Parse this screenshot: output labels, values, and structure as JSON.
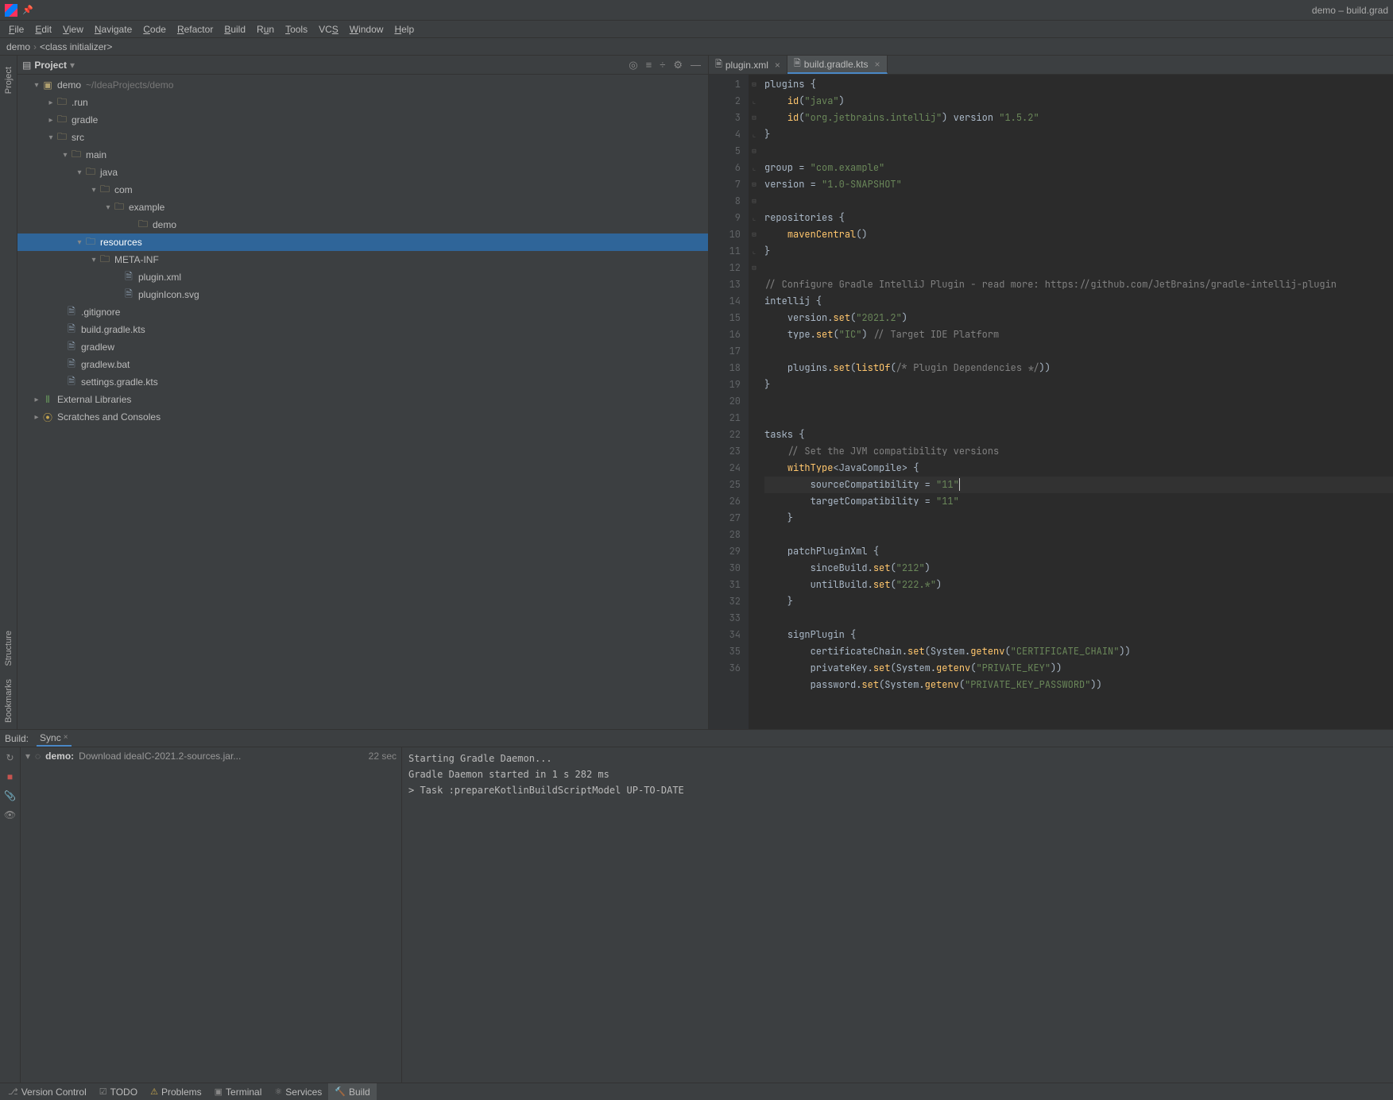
{
  "window_title": "demo – build.grad",
  "menu": [
    "File",
    "Edit",
    "View",
    "Navigate",
    "Code",
    "Refactor",
    "Build",
    "Run",
    "Tools",
    "VCS",
    "Window",
    "Help"
  ],
  "breadcrumbs": [
    "demo",
    "<class initializer>"
  ],
  "project_panel": {
    "title": "Project",
    "tree": {
      "root": {
        "label": "demo",
        "hint": "~/IdeaProjects/demo"
      },
      "run": ".run",
      "gradle": "gradle",
      "src": "src",
      "main": "main",
      "java": "java",
      "com": "com",
      "example": "example",
      "demo_leaf": "demo",
      "resources": "resources",
      "metainf": "META-INF",
      "pluginxml": "plugin.xml",
      "pluginicon": "pluginIcon.svg",
      "gitignore": ".gitignore",
      "buildgradle": "build.gradle.kts",
      "gradlew": "gradlew",
      "gradlewbat": "gradlew.bat",
      "settings": "settings.gradle.kts",
      "ext": "External Libraries",
      "scratch": "Scratches and Consoles"
    }
  },
  "left_tabs": {
    "project": "Project",
    "structure": "Structure",
    "bookmarks": "Bookmarks"
  },
  "tabs": [
    {
      "label": "plugin.xml",
      "active": false
    },
    {
      "label": "build.gradle.kts",
      "active": true
    }
  ],
  "editor": {
    "lines": 36
  },
  "build": {
    "label": "Build:",
    "tab": "Sync",
    "task_name": "demo:",
    "task_desc": "Download ideaIC-2021.2-sources.jar...",
    "task_time": "22 sec",
    "console": [
      "Starting Gradle Daemon...",
      "Gradle Daemon started in 1 s 282 ms",
      "> Task :prepareKotlinBuildScriptModel UP-TO-DATE"
    ]
  },
  "status": {
    "vcs": "Version Control",
    "todo": "TODO",
    "problems": "Problems",
    "terminal": "Terminal",
    "services": "Services",
    "build": "Build"
  }
}
